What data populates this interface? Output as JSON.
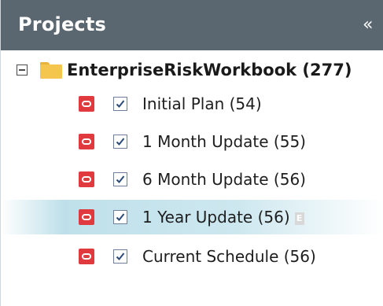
{
  "panel": {
    "title": "Projects",
    "collapse_glyph": "«"
  },
  "tree": {
    "root": {
      "label": "EnterpriseRiskWorkbook (277)",
      "expanded": true,
      "icon": "folder-icon"
    },
    "items": [
      {
        "label": "Initial  Plan (54)",
        "checked": true,
        "selected": false
      },
      {
        "label": "1 Month Update (55)",
        "checked": true,
        "selected": false
      },
      {
        "label": "6 Month Update (56)",
        "checked": true,
        "selected": false
      },
      {
        "label": "1 Year Update (56)",
        "checked": true,
        "selected": true,
        "badge": "E"
      },
      {
        "label": "Current Schedule (56)",
        "checked": true,
        "selected": false
      }
    ]
  },
  "colors": {
    "header_bg": "#5a6670",
    "risk_icon": "#e03a3e",
    "folder": "#f5c64d",
    "selection": "#cde7ef"
  }
}
